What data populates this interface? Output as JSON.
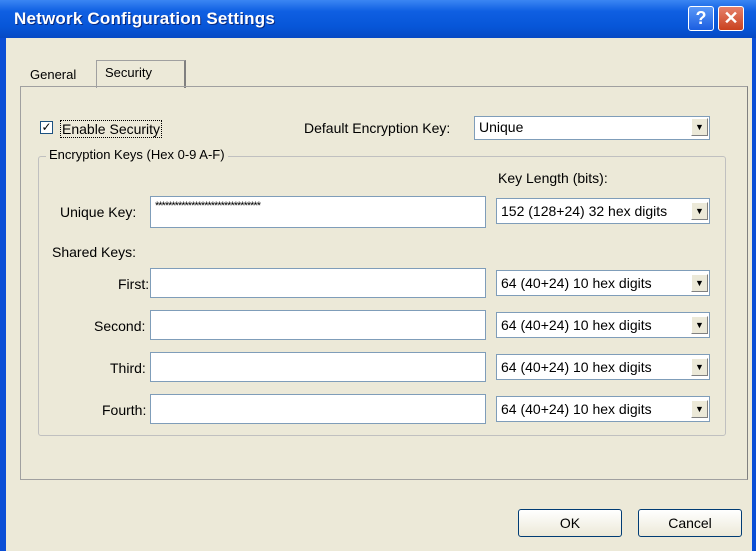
{
  "window": {
    "title": "Network Configuration Settings",
    "help_icon": "question-mark",
    "close_icon": "close-x"
  },
  "tabs": [
    {
      "label": "General",
      "selected": false
    },
    {
      "label": "Security",
      "selected": true
    }
  ],
  "security": {
    "enable_label": "Enable Security",
    "enable_checked": true,
    "default_key_label": "Default Encryption Key:",
    "default_key_value": "Unique",
    "group_title": "Encryption Keys (Hex 0-9 A-F)",
    "key_length_label": "Key Length (bits):",
    "unique_key_label": "Unique Key:",
    "unique_key_value": "********************************",
    "unique_key_length": "152 (128+24) 32 hex digits",
    "shared_keys_label": "Shared Keys:",
    "shared_keys": [
      {
        "label": "First:",
        "value": "",
        "length": "64  (40+24)  10 hex digits"
      },
      {
        "label": "Second:",
        "value": "",
        "length": "64  (40+24)  10 hex digits"
      },
      {
        "label": "Third:",
        "value": "",
        "length": "64  (40+24)  10 hex digits"
      },
      {
        "label": "Fourth:",
        "value": "",
        "length": "64  (40+24)  10 hex digits"
      }
    ]
  },
  "buttons": {
    "ok_label": "OK",
    "cancel_label": "Cancel"
  },
  "colors": {
    "titlebar": "#0a4ed6",
    "dialog_face": "#ece9d8",
    "field_border": "#7f9db9",
    "close_button": "#c9411f"
  }
}
